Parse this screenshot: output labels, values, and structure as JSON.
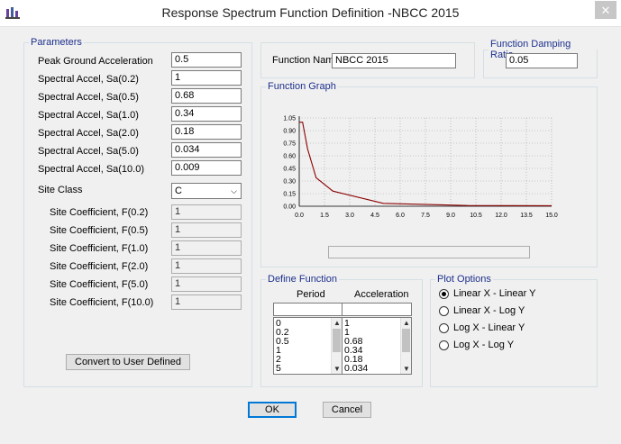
{
  "window": {
    "title": "Response Spectrum Function Definition -NBCC 2015",
    "close_glyph": "✕"
  },
  "parameters": {
    "legend": "Parameters",
    "fields": [
      {
        "label": "Peak Ground Acceleration",
        "value": "0.5"
      },
      {
        "label": "Spectral Accel, Sa(0.2)",
        "value": "1"
      },
      {
        "label": "Spectral Accel, Sa(0.5)",
        "value": "0.68"
      },
      {
        "label": "Spectral Accel, Sa(1.0)",
        "value": "0.34"
      },
      {
        "label": "Spectral Accel, Sa(2.0)",
        "value": "0.18"
      },
      {
        "label": "Spectral Accel, Sa(5.0)",
        "value": "0.034"
      },
      {
        "label": "Spectral Accel, Sa(10.0)",
        "value": "0.009"
      }
    ],
    "site_class": {
      "label": "Site Class",
      "value": "C"
    },
    "site_coefficients": [
      {
        "label": "Site Coefficient, F(0.2)",
        "value": "1"
      },
      {
        "label": "Site Coefficient, F(0.5)",
        "value": "1"
      },
      {
        "label": "Site Coefficient, F(1.0)",
        "value": "1"
      },
      {
        "label": "Site Coefficient, F(2.0)",
        "value": "1"
      },
      {
        "label": "Site Coefficient, F(5.0)",
        "value": "1"
      },
      {
        "label": "Site Coefficient, F(10.0)",
        "value": "1"
      }
    ],
    "convert_button": "Convert to User Defined"
  },
  "function_name": {
    "label": "Function Name",
    "value": "NBCC 2015"
  },
  "damping": {
    "legend": "Function Damping Ratio",
    "value": "0.05"
  },
  "graph": {
    "legend": "Function Graph"
  },
  "define_function": {
    "legend": "Define Function",
    "period_header": "Period",
    "accel_header": "Acceleration",
    "periods": [
      "0",
      "0.2",
      "0.5",
      "1",
      "2",
      "5"
    ],
    "accelerations": [
      "1",
      "1",
      "0.68",
      "0.34",
      "0.18",
      "0.034"
    ]
  },
  "plot_options": {
    "legend": "Plot Options",
    "options": [
      {
        "label": "Linear X - Linear Y",
        "selected": true
      },
      {
        "label": "Linear X - Log Y",
        "selected": false
      },
      {
        "label": "Log X - Linear Y",
        "selected": false
      },
      {
        "label": "Log X - Log Y",
        "selected": false
      }
    ]
  },
  "buttons": {
    "ok": "OK",
    "cancel": "Cancel"
  },
  "chart_data": {
    "type": "line",
    "title": "",
    "xlabel": "",
    "ylabel": "",
    "xlim": [
      0,
      15
    ],
    "ylim": [
      0,
      1.05
    ],
    "x_ticks": [
      "0.0",
      "1.5",
      "3.0",
      "4.5",
      "6.0",
      "7.5",
      "9.0",
      "10.5",
      "12.0",
      "13.5",
      "15.0"
    ],
    "y_ticks": [
      "0.00",
      "0.15",
      "0.30",
      "0.45",
      "0.60",
      "0.75",
      "0.90",
      "1.05"
    ],
    "grid": true,
    "line_color": "#8b0000",
    "series": [
      {
        "x": [
          0,
          0.2,
          0.5,
          1,
          2,
          5,
          10,
          15
        ],
        "y": [
          1,
          1,
          0.68,
          0.34,
          0.18,
          0.034,
          0.009,
          0.006
        ]
      }
    ]
  }
}
